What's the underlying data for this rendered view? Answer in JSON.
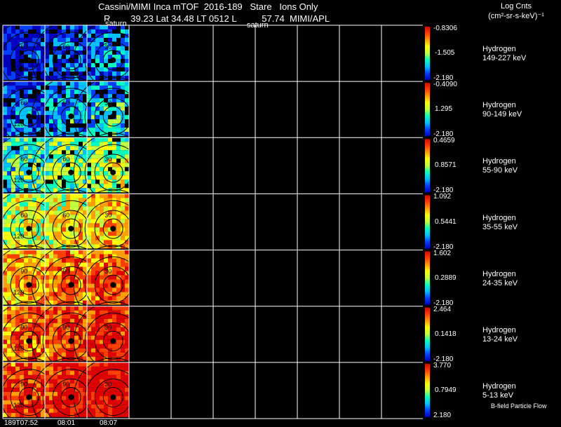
{
  "header": {
    "title": "Cassini/MIMI Inca mTOF  2016-189   Stare   Ions Only",
    "line2": "R        39.23 Lat 34.48 LT 0512 L          57.74  MIMI/APL",
    "panel_label_1": "saturn",
    "panel_label_2": "saturn"
  },
  "units": {
    "title": "Log Cnts",
    "value": "(cm²-sr-s-keV)⁻¹"
  },
  "rows": [
    {
      "species": "Hydrogen",
      "energy": "149-227 keV",
      "max": "-0.8306",
      "mid": "-1.505",
      "min": "-2.180",
      "hot": 0.15
    },
    {
      "species": "Hydrogen",
      "energy": "90-149 keV",
      "max": "-0.4090",
      "mid": "1.295",
      "min": "-2.180",
      "hot": 0.25
    },
    {
      "species": "Hydrogen",
      "energy": "55-90 keV",
      "max": "0.4659",
      "mid": "0.8571",
      "min": "-2.180",
      "hot": 0.45
    },
    {
      "species": "Hydrogen",
      "energy": "35-55 keV",
      "max": "1.092",
      "mid": "0.5441",
      "min": "-2.180",
      "hot": 0.6
    },
    {
      "species": "Hydrogen",
      "energy": "24-35 keV",
      "max": "1.602",
      "mid": "0.2889",
      "min": "-2.180",
      "hot": 0.75
    },
    {
      "species": "Hydrogen",
      "energy": "13-24 keV",
      "max": "2.464",
      "mid": "0.1418",
      "min": "-2.180",
      "hot": 0.85
    },
    {
      "species": "Hydrogen",
      "energy": "5-13 keV",
      "max": "3.770",
      "mid": "0.7949",
      "min": "2.180",
      "hot": 0.92
    }
  ],
  "times": [
    "189T07:52",
    "08:01",
    "08:07"
  ],
  "contour_labels": [
    "30",
    "60",
    "90",
    "120",
    "150"
  ],
  "footer_note": "B-field Particle Flow",
  "colors": {
    "background": "#000000",
    "grid": "#ffffff",
    "colorbar": [
      "#0000c0",
      "#0040ff",
      "#00c0ff",
      "#00ffc0",
      "#c0ff40",
      "#ffff00",
      "#ffa000",
      "#ff4000",
      "#e00000"
    ]
  }
}
